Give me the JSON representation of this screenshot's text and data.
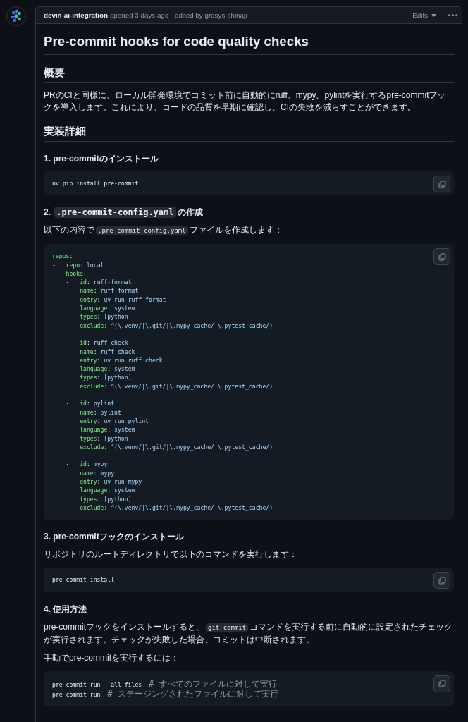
{
  "header": {
    "author": "devin-ai-integration",
    "meta": "opened 3 days ago · edited by grasys-shinaji",
    "edits_button": "Edits"
  },
  "title": "Pre-commit hooks for code quality checks",
  "blocks": [
    {
      "kind": "h2",
      "parts": [
        {
          "kind": "text",
          "text": "概要"
        }
      ]
    },
    {
      "kind": "p",
      "parts": [
        {
          "kind": "text",
          "text": "PRのCIと同様に、ローカル開発環境でコミット前に自動的にruff、mypy、pylintを実行するpre-commitフックを導入します。これにより、コードの品質を早期に確認し、CIの失敗を減らすことができます。"
        }
      ]
    },
    {
      "kind": "h2",
      "parts": [
        {
          "kind": "text",
          "text": "実装詳細"
        }
      ]
    },
    {
      "kind": "h3",
      "parts": [
        {
          "kind": "text",
          "text": "1. pre-commitのインストール"
        }
      ]
    },
    {
      "kind": "code",
      "lines": [
        {
          "tokens": [
            {
              "kind": "plain",
              "text": "uv pip install pre-commit"
            }
          ]
        }
      ]
    },
    {
      "kind": "h3",
      "parts": [
        {
          "kind": "text",
          "text": "2. "
        },
        {
          "kind": "code",
          "text": ".pre-commit-config.yaml"
        },
        {
          "kind": "text",
          "text": "の作成"
        }
      ]
    },
    {
      "kind": "p",
      "parts": [
        {
          "kind": "text",
          "text": "以下の内容で"
        },
        {
          "kind": "code",
          "text": ".pre-commit-config.yaml"
        },
        {
          "kind": "text",
          "text": "ファイルを作成します："
        }
      ]
    },
    {
      "kind": "code",
      "lines": [
        {
          "tokens": [
            {
              "kind": "key",
              "text": "repos"
            },
            {
              "kind": "plain",
              "text": ":"
            }
          ]
        },
        {
          "tokens": [
            {
              "kind": "plain",
              "text": "-   "
            },
            {
              "kind": "key",
              "text": "repo"
            },
            {
              "kind": "plain",
              "text": ": "
            },
            {
              "kind": "value",
              "text": "local"
            }
          ]
        },
        {
          "tokens": [
            {
              "kind": "key",
              "text": "    hooks"
            },
            {
              "kind": "plain",
              "text": ":"
            }
          ]
        },
        {
          "tokens": [
            {
              "kind": "plain",
              "text": "    -   "
            },
            {
              "kind": "key",
              "text": "id"
            },
            {
              "kind": "plain",
              "text": ": "
            },
            {
              "kind": "value",
              "text": "ruff-format"
            }
          ]
        },
        {
          "tokens": [
            {
              "kind": "key",
              "text": "        name"
            },
            {
              "kind": "plain",
              "text": ": "
            },
            {
              "kind": "value",
              "text": "ruff format"
            }
          ]
        },
        {
          "tokens": [
            {
              "kind": "key",
              "text": "        entry"
            },
            {
              "kind": "plain",
              "text": ": "
            },
            {
              "kind": "value",
              "text": "uv run ruff format"
            }
          ]
        },
        {
          "tokens": [
            {
              "kind": "key",
              "text": "        language"
            },
            {
              "kind": "plain",
              "text": ": "
            },
            {
              "kind": "value",
              "text": "system"
            }
          ]
        },
        {
          "tokens": [
            {
              "kind": "key",
              "text": "        types"
            },
            {
              "kind": "plain",
              "text": ": "
            },
            {
              "kind": "value",
              "text": "[python]"
            }
          ]
        },
        {
          "tokens": [
            {
              "kind": "key",
              "text": "        exclude"
            },
            {
              "kind": "plain",
              "text": ": "
            },
            {
              "kind": "value",
              "text": "^(\\.venv/|\\.git/|\\.mypy_cache/|\\.pytest_cache/)"
            }
          ]
        },
        {
          "blank_before": true,
          "tokens": [
            {
              "kind": "plain",
              "text": "    -   "
            },
            {
              "kind": "key",
              "text": "id"
            },
            {
              "kind": "plain",
              "text": ": "
            },
            {
              "kind": "value",
              "text": "ruff-check"
            }
          ]
        },
        {
          "tokens": [
            {
              "kind": "key",
              "text": "        name"
            },
            {
              "kind": "plain",
              "text": ": "
            },
            {
              "kind": "value",
              "text": "ruff check"
            }
          ]
        },
        {
          "tokens": [
            {
              "kind": "key",
              "text": "        entry"
            },
            {
              "kind": "plain",
              "text": ": "
            },
            {
              "kind": "value",
              "text": "uv run ruff check"
            }
          ]
        },
        {
          "tokens": [
            {
              "kind": "key",
              "text": "        language"
            },
            {
              "kind": "plain",
              "text": ": "
            },
            {
              "kind": "value",
              "text": "system"
            }
          ]
        },
        {
          "tokens": [
            {
              "kind": "key",
              "text": "        types"
            },
            {
              "kind": "plain",
              "text": ": "
            },
            {
              "kind": "value",
              "text": "[python]"
            }
          ]
        },
        {
          "tokens": [
            {
              "kind": "key",
              "text": "        exclude"
            },
            {
              "kind": "plain",
              "text": ": "
            },
            {
              "kind": "value",
              "text": "^(\\.venv/|\\.git/|\\.mypy_cache/|\\.pytest_cache/)"
            }
          ]
        },
        {
          "blank_before": true,
          "tokens": [
            {
              "kind": "plain",
              "text": "    -   "
            },
            {
              "kind": "key",
              "text": "id"
            },
            {
              "kind": "plain",
              "text": ": "
            },
            {
              "kind": "value",
              "text": "pylint"
            }
          ]
        },
        {
          "tokens": [
            {
              "kind": "key",
              "text": "        name"
            },
            {
              "kind": "plain",
              "text": ": "
            },
            {
              "kind": "value",
              "text": "pylint"
            }
          ]
        },
        {
          "tokens": [
            {
              "kind": "key",
              "text": "        entry"
            },
            {
              "kind": "plain",
              "text": ": "
            },
            {
              "kind": "value",
              "text": "uv run pylint"
            }
          ]
        },
        {
          "tokens": [
            {
              "kind": "key",
              "text": "        language"
            },
            {
              "kind": "plain",
              "text": ": "
            },
            {
              "kind": "value",
              "text": "system"
            }
          ]
        },
        {
          "tokens": [
            {
              "kind": "key",
              "text": "        types"
            },
            {
              "kind": "plain",
              "text": ": "
            },
            {
              "kind": "value",
              "text": "[python]"
            }
          ]
        },
        {
          "tokens": [
            {
              "kind": "key",
              "text": "        exclude"
            },
            {
              "kind": "plain",
              "text": ": "
            },
            {
              "kind": "value",
              "text": "^(\\.venv/|\\.git/|\\.mypy_cache/|\\.pytest_cache/)"
            }
          ]
        },
        {
          "blank_before": true,
          "tokens": [
            {
              "kind": "plain",
              "text": "    -   "
            },
            {
              "kind": "key",
              "text": "id"
            },
            {
              "kind": "plain",
              "text": ": "
            },
            {
              "kind": "value",
              "text": "mypy"
            }
          ]
        },
        {
          "tokens": [
            {
              "kind": "key",
              "text": "        name"
            },
            {
              "kind": "plain",
              "text": ": "
            },
            {
              "kind": "value",
              "text": "mypy"
            }
          ]
        },
        {
          "tokens": [
            {
              "kind": "key",
              "text": "        entry"
            },
            {
              "kind": "plain",
              "text": ": "
            },
            {
              "kind": "value",
              "text": "uv run mypy"
            }
          ]
        },
        {
          "tokens": [
            {
              "kind": "key",
              "text": "        language"
            },
            {
              "kind": "plain",
              "text": ": "
            },
            {
              "kind": "value",
              "text": "system"
            }
          ]
        },
        {
          "tokens": [
            {
              "kind": "key",
              "text": "        types"
            },
            {
              "kind": "plain",
              "text": ": "
            },
            {
              "kind": "value",
              "text": "[python]"
            }
          ]
        },
        {
          "tokens": [
            {
              "kind": "key",
              "text": "        exclude"
            },
            {
              "kind": "plain",
              "text": ": "
            },
            {
              "kind": "value",
              "text": "^(\\.venv/|\\.git/|\\.mypy_cache/|\\.pytest_cache/)"
            }
          ]
        }
      ]
    },
    {
      "kind": "h3",
      "parts": [
        {
          "kind": "text",
          "text": "3. pre-commitフックのインストール"
        }
      ]
    },
    {
      "kind": "p",
      "parts": [
        {
          "kind": "text",
          "text": "リポジトリのルートディレクトリで以下のコマンドを実行します："
        }
      ]
    },
    {
      "kind": "code",
      "lines": [
        {
          "tokens": [
            {
              "kind": "plain",
              "text": "pre-commit install"
            }
          ]
        }
      ]
    },
    {
      "kind": "h3",
      "parts": [
        {
          "kind": "text",
          "text": "4. 使用方法"
        }
      ]
    },
    {
      "kind": "p",
      "parts": [
        {
          "kind": "text",
          "text": "pre-commitフックをインストールすると、"
        },
        {
          "kind": "code",
          "text": "git commit"
        },
        {
          "kind": "text",
          "text": "コマンドを実行する前に自動的に設定されたチェックが実行されます。チェックが失敗した場合、コミットは中断されます。"
        }
      ]
    },
    {
      "kind": "p",
      "parts": [
        {
          "kind": "text",
          "text": "手動でpre-commitを実行するには："
        }
      ]
    },
    {
      "kind": "code",
      "lines": [
        {
          "tokens": [
            {
              "kind": "plain",
              "text": "pre-commit run --all-files  "
            },
            {
              "kind": "comment",
              "text": "# すべてのファイルに対して実行"
            }
          ]
        },
        {
          "tokens": [
            {
              "kind": "plain",
              "text": "pre-commit run  "
            },
            {
              "kind": "comment",
              "text": "# ステージングされたファイルに対して実行"
            }
          ]
        }
      ]
    }
  ]
}
